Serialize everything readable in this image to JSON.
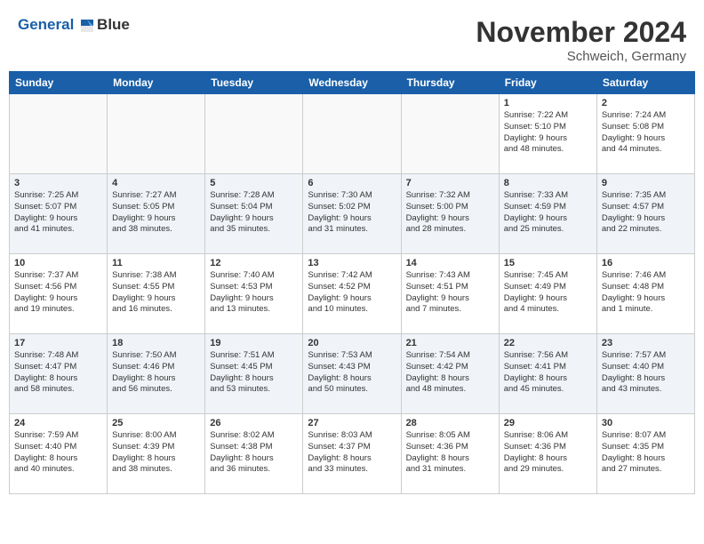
{
  "logo": {
    "line1": "General",
    "line2": "Blue"
  },
  "title": "November 2024",
  "location": "Schweich, Germany",
  "weekdays": [
    "Sunday",
    "Monday",
    "Tuesday",
    "Wednesday",
    "Thursday",
    "Friday",
    "Saturday"
  ],
  "weeks": [
    [
      {
        "day": "",
        "info": ""
      },
      {
        "day": "",
        "info": ""
      },
      {
        "day": "",
        "info": ""
      },
      {
        "day": "",
        "info": ""
      },
      {
        "day": "",
        "info": ""
      },
      {
        "day": "1",
        "info": "Sunrise: 7:22 AM\nSunset: 5:10 PM\nDaylight: 9 hours\nand 48 minutes."
      },
      {
        "day": "2",
        "info": "Sunrise: 7:24 AM\nSunset: 5:08 PM\nDaylight: 9 hours\nand 44 minutes."
      }
    ],
    [
      {
        "day": "3",
        "info": "Sunrise: 7:25 AM\nSunset: 5:07 PM\nDaylight: 9 hours\nand 41 minutes."
      },
      {
        "day": "4",
        "info": "Sunrise: 7:27 AM\nSunset: 5:05 PM\nDaylight: 9 hours\nand 38 minutes."
      },
      {
        "day": "5",
        "info": "Sunrise: 7:28 AM\nSunset: 5:04 PM\nDaylight: 9 hours\nand 35 minutes."
      },
      {
        "day": "6",
        "info": "Sunrise: 7:30 AM\nSunset: 5:02 PM\nDaylight: 9 hours\nand 31 minutes."
      },
      {
        "day": "7",
        "info": "Sunrise: 7:32 AM\nSunset: 5:00 PM\nDaylight: 9 hours\nand 28 minutes."
      },
      {
        "day": "8",
        "info": "Sunrise: 7:33 AM\nSunset: 4:59 PM\nDaylight: 9 hours\nand 25 minutes."
      },
      {
        "day": "9",
        "info": "Sunrise: 7:35 AM\nSunset: 4:57 PM\nDaylight: 9 hours\nand 22 minutes."
      }
    ],
    [
      {
        "day": "10",
        "info": "Sunrise: 7:37 AM\nSunset: 4:56 PM\nDaylight: 9 hours\nand 19 minutes."
      },
      {
        "day": "11",
        "info": "Sunrise: 7:38 AM\nSunset: 4:55 PM\nDaylight: 9 hours\nand 16 minutes."
      },
      {
        "day": "12",
        "info": "Sunrise: 7:40 AM\nSunset: 4:53 PM\nDaylight: 9 hours\nand 13 minutes."
      },
      {
        "day": "13",
        "info": "Sunrise: 7:42 AM\nSunset: 4:52 PM\nDaylight: 9 hours\nand 10 minutes."
      },
      {
        "day": "14",
        "info": "Sunrise: 7:43 AM\nSunset: 4:51 PM\nDaylight: 9 hours\nand 7 minutes."
      },
      {
        "day": "15",
        "info": "Sunrise: 7:45 AM\nSunset: 4:49 PM\nDaylight: 9 hours\nand 4 minutes."
      },
      {
        "day": "16",
        "info": "Sunrise: 7:46 AM\nSunset: 4:48 PM\nDaylight: 9 hours\nand 1 minute."
      }
    ],
    [
      {
        "day": "17",
        "info": "Sunrise: 7:48 AM\nSunset: 4:47 PM\nDaylight: 8 hours\nand 58 minutes."
      },
      {
        "day": "18",
        "info": "Sunrise: 7:50 AM\nSunset: 4:46 PM\nDaylight: 8 hours\nand 56 minutes."
      },
      {
        "day": "19",
        "info": "Sunrise: 7:51 AM\nSunset: 4:45 PM\nDaylight: 8 hours\nand 53 minutes."
      },
      {
        "day": "20",
        "info": "Sunrise: 7:53 AM\nSunset: 4:43 PM\nDaylight: 8 hours\nand 50 minutes."
      },
      {
        "day": "21",
        "info": "Sunrise: 7:54 AM\nSunset: 4:42 PM\nDaylight: 8 hours\nand 48 minutes."
      },
      {
        "day": "22",
        "info": "Sunrise: 7:56 AM\nSunset: 4:41 PM\nDaylight: 8 hours\nand 45 minutes."
      },
      {
        "day": "23",
        "info": "Sunrise: 7:57 AM\nSunset: 4:40 PM\nDaylight: 8 hours\nand 43 minutes."
      }
    ],
    [
      {
        "day": "24",
        "info": "Sunrise: 7:59 AM\nSunset: 4:40 PM\nDaylight: 8 hours\nand 40 minutes."
      },
      {
        "day": "25",
        "info": "Sunrise: 8:00 AM\nSunset: 4:39 PM\nDaylight: 8 hours\nand 38 minutes."
      },
      {
        "day": "26",
        "info": "Sunrise: 8:02 AM\nSunset: 4:38 PM\nDaylight: 8 hours\nand 36 minutes."
      },
      {
        "day": "27",
        "info": "Sunrise: 8:03 AM\nSunset: 4:37 PM\nDaylight: 8 hours\nand 33 minutes."
      },
      {
        "day": "28",
        "info": "Sunrise: 8:05 AM\nSunset: 4:36 PM\nDaylight: 8 hours\nand 31 minutes."
      },
      {
        "day": "29",
        "info": "Sunrise: 8:06 AM\nSunset: 4:36 PM\nDaylight: 8 hours\nand 29 minutes."
      },
      {
        "day": "30",
        "info": "Sunrise: 8:07 AM\nSunset: 4:35 PM\nDaylight: 8 hours\nand 27 minutes."
      }
    ]
  ]
}
